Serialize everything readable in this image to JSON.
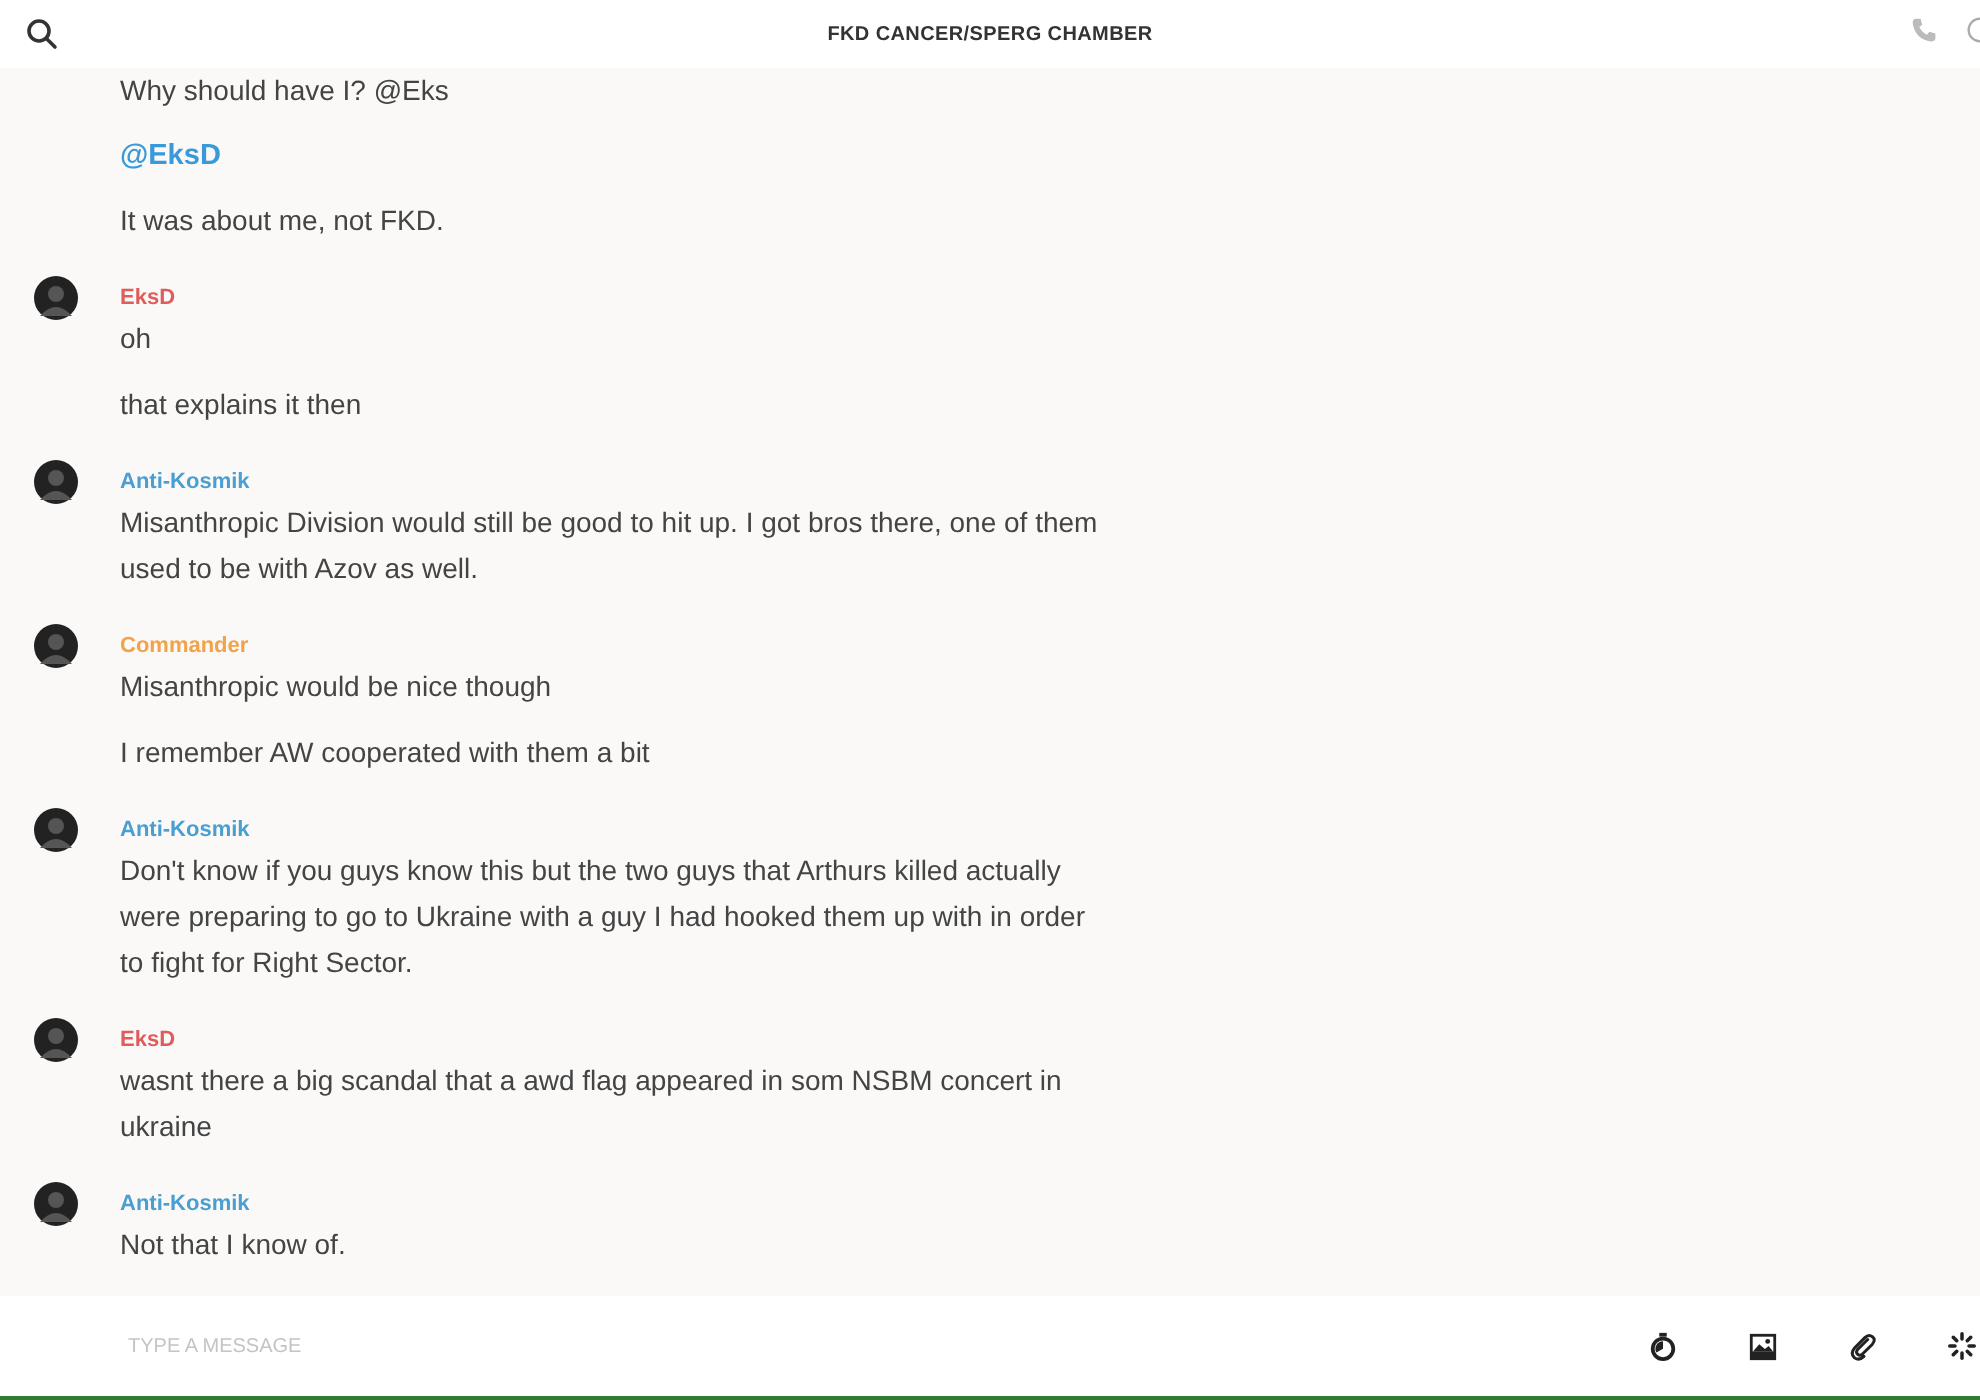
{
  "header": {
    "title": "FKD CANCER/SPERG CHAMBER"
  },
  "messages": [
    {
      "lines": [
        {
          "kind": "text",
          "text": "Why should have I? @Eks"
        },
        {
          "kind": "mention",
          "text": "@EksD"
        },
        {
          "kind": "text",
          "text": "It was about me, not FKD."
        }
      ]
    },
    {
      "author": "EksD",
      "color": "#e05b5b",
      "lines": [
        {
          "kind": "text",
          "text": "oh"
        },
        {
          "kind": "text",
          "text": "that explains it then"
        }
      ]
    },
    {
      "author": "Anti-Kosmik",
      "color": "#4a9fd0",
      "lines": [
        {
          "kind": "text",
          "text": "Misanthropic Division would still be good to hit up. I got bros there, one of them used to be with Azov as well."
        }
      ]
    },
    {
      "author": "Commander",
      "color": "#f2a24a",
      "lines": [
        {
          "kind": "text",
          "text": "Misanthropic would be nice though"
        },
        {
          "kind": "text",
          "text": "I remember AW cooperated with them a bit"
        }
      ]
    },
    {
      "author": "Anti-Kosmik",
      "color": "#4a9fd0",
      "lines": [
        {
          "kind": "text",
          "text": "Don't know if you guys know this but the two guys that Arthurs killed actually were preparing to go to Ukraine with a guy I had hooked them up with in order to fight for Right Sector."
        }
      ]
    },
    {
      "author": "EksD",
      "color": "#e05b5b",
      "lines": [
        {
          "kind": "text",
          "text": "wasnt there a big scandal that a awd flag appeared in som NSBM concert in ukraine"
        }
      ]
    },
    {
      "author": "Anti-Kosmik",
      "color": "#4a9fd0",
      "lines": [
        {
          "kind": "text",
          "text": "Not that I know of."
        }
      ]
    }
  ],
  "composer": {
    "placeholder": "TYPE A MESSAGE"
  }
}
